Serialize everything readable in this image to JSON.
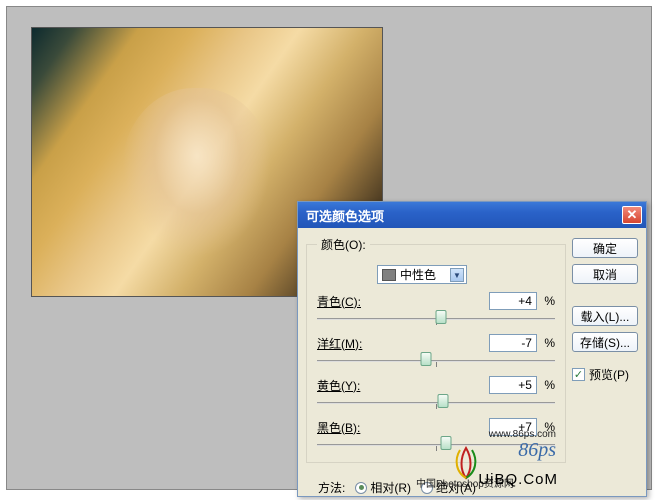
{
  "dialog": {
    "title": "可选颜色选项",
    "color_label": "颜色(O):",
    "color_value": "中性色",
    "sliders": {
      "cyan": {
        "label": "青色(C):",
        "value": "+4",
        "thumb_pct": 52
      },
      "magenta": {
        "label": "洋红(M):",
        "value": "-7",
        "thumb_pct": 46
      },
      "yellow": {
        "label": "黄色(Y):",
        "value": "+5",
        "thumb_pct": 53
      },
      "black": {
        "label": "黑色(B):",
        "value": "+7",
        "thumb_pct": 54
      }
    },
    "percent": "%",
    "method_label": "方法:",
    "method_relative": "相对(R)",
    "method_absolute": "绝对(A)",
    "buttons": {
      "ok": "确定",
      "cancel": "取消",
      "load": "载入(L)...",
      "save": "存储(S)..."
    },
    "preview_label": "预览(P)",
    "preview_checked": "✓"
  },
  "watermark": {
    "url": "www.86ps.com",
    "brand": "86ps",
    "sub": "中国Photoshop资源网",
    "uibq": "UiBQ.CoM"
  }
}
